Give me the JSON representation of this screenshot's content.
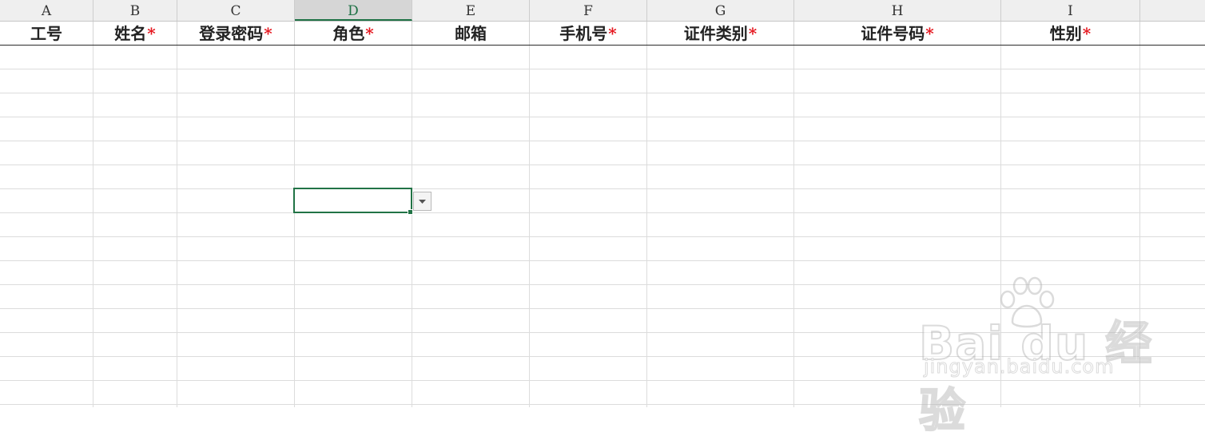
{
  "columns": [
    {
      "letter": "A",
      "header": "工号",
      "required": false
    },
    {
      "letter": "B",
      "header": "姓名",
      "required": true
    },
    {
      "letter": "C",
      "header": "登录密码",
      "required": true
    },
    {
      "letter": "D",
      "header": "角色",
      "required": true,
      "active": true
    },
    {
      "letter": "E",
      "header": "邮箱",
      "required": false
    },
    {
      "letter": "F",
      "header": "手机号",
      "required": true
    },
    {
      "letter": "G",
      "header": "证件类别",
      "required": true
    },
    {
      "letter": "H",
      "header": "证件号码",
      "required": true
    },
    {
      "letter": "I",
      "header": "性别",
      "required": true
    }
  ],
  "required_marker": "*",
  "selected_cell": {
    "column": "D",
    "value": ""
  },
  "dropdown_icon": "chevron-down-icon",
  "watermark": {
    "brand": "Bai du 经验",
    "url": "jingyan.baidu.com",
    "icon": "paw-icon"
  },
  "colors": {
    "selection": "#217346",
    "required": "#e5141c",
    "header_bg": "#efefef"
  }
}
